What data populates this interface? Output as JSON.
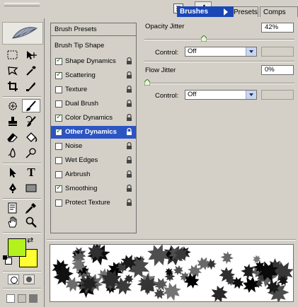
{
  "toolbox": {
    "fg_color": "#b3f21c",
    "bg_color": "#ffff33",
    "tools": [
      "marquee-icon",
      "move-icon",
      "lasso-icon",
      "magic-wand-icon",
      "crop-icon",
      "slice-icon",
      "healing-brush-icon",
      "brush-icon",
      "clone-stamp-icon",
      "history-brush-icon",
      "eraser-icon",
      "paint-bucket-icon",
      "blur-icon",
      "dodge-icon",
      "path-select-icon",
      "type-icon",
      "pen-icon",
      "rectangle-icon",
      "notes-icon",
      "eyedropper-icon",
      "hand-icon",
      "zoom-icon"
    ],
    "type_glyph": "T"
  },
  "tabs": {
    "brushes": "Brushes",
    "presets": "Presets",
    "comps": "Comps"
  },
  "list": {
    "brush_presets": "Brush Presets",
    "brush_tip_shape": "Brush Tip Shape",
    "items": [
      {
        "label": "Shape Dynamics",
        "checked": true
      },
      {
        "label": "Scattering",
        "checked": true
      },
      {
        "label": "Texture",
        "checked": false
      },
      {
        "label": "Dual Brush",
        "checked": false
      },
      {
        "label": "Color Dynamics",
        "checked": true
      },
      {
        "label": "Other Dynamics",
        "checked": true,
        "selected": true
      },
      {
        "label": "Noise",
        "checked": false
      },
      {
        "label": "Wet Edges",
        "checked": false
      },
      {
        "label": "Airbrush",
        "checked": false
      },
      {
        "label": "Smoothing",
        "checked": true
      },
      {
        "label": "Protect Texture",
        "checked": false
      }
    ]
  },
  "opacity": {
    "label": "Opacity Jitter",
    "value": "42%",
    "level": 0.42,
    "control_label": "Control:",
    "control_value": "Off"
  },
  "flow": {
    "label": "Flow Jitter",
    "value": "0%",
    "level": 0,
    "control_label": "Control:",
    "control_value": "Off"
  }
}
